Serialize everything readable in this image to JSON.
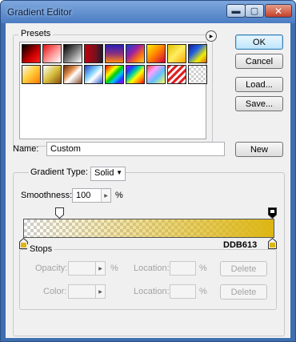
{
  "window": {
    "title": "Gradient Editor",
    "min_glyph": "▬",
    "max_glyph": "▢",
    "close_glyph": "✕"
  },
  "presets": {
    "label": "Presets",
    "menu_glyph": "▶",
    "swatches": [
      {
        "name": "foreground-to-background",
        "css": "linear-gradient(135deg,#000 0%,#c00 60%,#ff2020 100%)"
      },
      {
        "name": "foreground-to-transparent",
        "css": "linear-gradient(135deg,#e01010 0%,#ff9a9a 55%,#fff 100%)"
      },
      {
        "name": "black-white",
        "css": "linear-gradient(135deg,#000 0%,#777 50%,#fff 100%)"
      },
      {
        "name": "red-black",
        "css": "linear-gradient(90deg,#c0000a 0%,#7a1020 60%,#1c1c2a 100%)"
      },
      {
        "name": "violet-orange",
        "css": "linear-gradient(180deg,#2a1fb8 0%,#8a3080 50%,#ff8a10 100%)"
      },
      {
        "name": "yellow-violet-orange-blue",
        "css": "linear-gradient(135deg,#1040d0 0%,#a020a0 40%,#ff7010 70%,#ffd030 100%)"
      },
      {
        "name": "copper",
        "css": "linear-gradient(135deg,#fff000 0%,#ff8000 50%,#d00040 100%)"
      },
      {
        "name": "chrome",
        "css": "linear-gradient(135deg,#e0c000 0%,#ffee60 50%,#ffa400 100%)"
      },
      {
        "name": "spectrum",
        "css": "linear-gradient(135deg,#1a1a90 0%,#2060e0 35%,#f0f000 70%,#e06010 100%)"
      },
      {
        "name": "transparent-rainbow",
        "css": "linear-gradient(135deg,#f5f5f5 0%,#ffd040 45%,#ff7a00 100%)"
      },
      {
        "name": "transparent-stripes",
        "css": "linear-gradient(135deg,#ffffff 0%,#d8c040 50%,#8a5010 100%)"
      },
      {
        "name": "neutral-density",
        "css": "linear-gradient(135deg,#6a2b0a 0%,#e09050 35%,#fff 55%,#8a5030 100%)"
      },
      {
        "name": "blue-yellow-blue",
        "css": "linear-gradient(135deg,#2040c0 0%,#80d0ff 40%,#fff 60%,#2a60d0 100%)"
      },
      {
        "name": "rainbow",
        "css": "linear-gradient(135deg,#ff0000 0%,#ff8800 17%,#ffff00 33%,#00d000 50%,#00c0ff 67%,#2040ff 83%,#b000ff 100%)"
      },
      {
        "name": "rainbow-2",
        "css": "linear-gradient(135deg,#b000ff 0%,#2040ff 20%,#00d0a0 40%,#ffff00 60%,#ff8800 80%,#ff0000 100%)"
      },
      {
        "name": "rainbow-3",
        "css": "linear-gradient(135deg,#ff4040 0%,#ffa0ff 30%,#60c0ff 60%,#ffff60 100%)"
      },
      {
        "name": "red-stripes",
        "css": "repeating-linear-gradient(135deg,#e02020 0px,#e02020 3px,#ffffff 3px,#ffffff 6px)"
      },
      {
        "name": "transparent",
        "css": "repeating-conic-gradient(#cfcfcf 0% 25%,#ffffff 0% 50%) 0 0/6px 6px"
      }
    ]
  },
  "buttons": {
    "ok": "OK",
    "cancel": "Cancel",
    "load": "Load...",
    "save": "Save...",
    "new": "New"
  },
  "name_field": {
    "label": "Name:",
    "value": "Custom"
  },
  "gradient": {
    "type_label": "Gradient Type:",
    "type_value": "Solid",
    "smoothness_label": "Smoothness:",
    "smoothness_value": "100",
    "smoothness_unit": "%",
    "end_color": "#DDB613",
    "end_color_label": "DDB613",
    "start_opacity_pct": 0,
    "end_opacity_pct": 100
  },
  "stops": {
    "label": "Stops",
    "opacity_label": "Opacity:",
    "opacity_unit": "%",
    "opacity_location_label": "Location:",
    "opacity_location_unit": "%",
    "opacity_delete": "Delete",
    "color_label": "Color:",
    "color_location_label": "Location:",
    "color_location_unit": "%",
    "color_delete": "Delete"
  }
}
